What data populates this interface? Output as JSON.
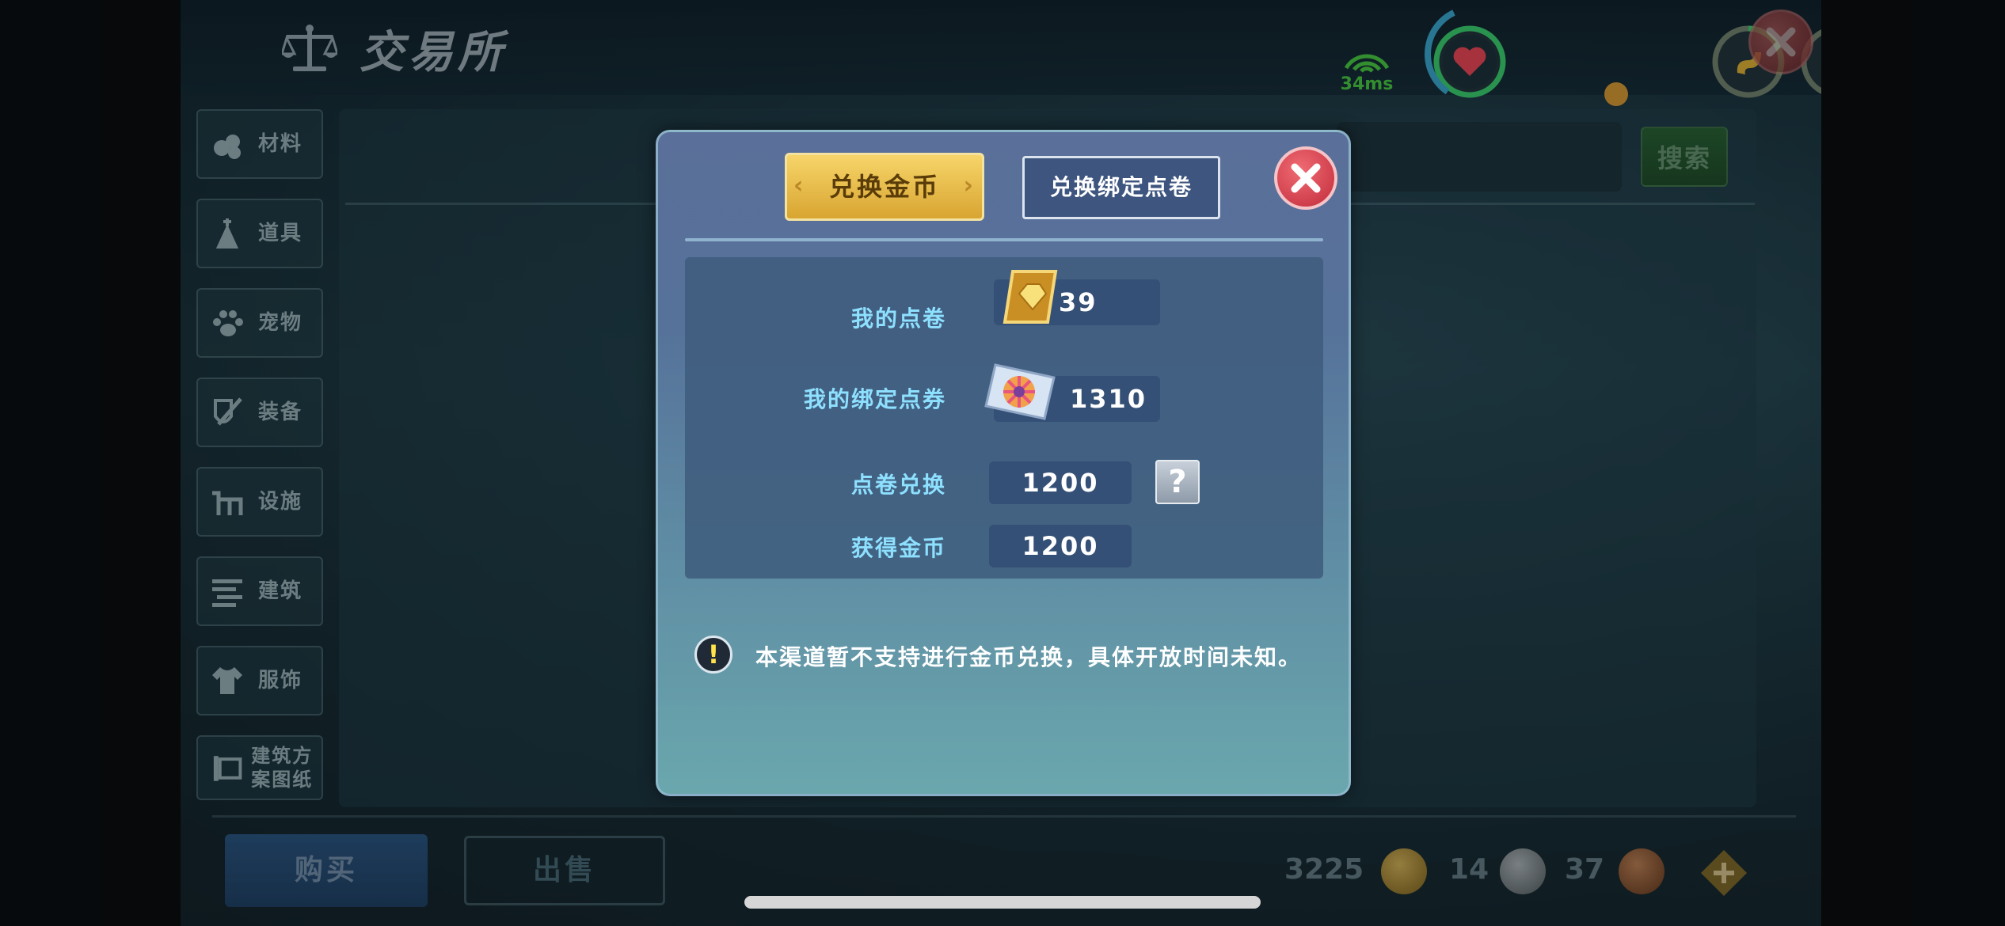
{
  "header": {
    "title": "交易所",
    "ping": "34ms"
  },
  "categories": [
    {
      "label": "材料",
      "icon": "material-icon"
    },
    {
      "label": "道具",
      "icon": "item-icon"
    },
    {
      "label": "宠物",
      "icon": "paw-icon"
    },
    {
      "label": "装备",
      "icon": "equipment-icon"
    },
    {
      "label": "设施",
      "icon": "facility-icon"
    },
    {
      "label": "建筑",
      "icon": "building-icon"
    },
    {
      "label": "服饰",
      "icon": "clothing-icon"
    },
    {
      "label": "建筑方案图纸",
      "icon": "blueprint-icon"
    }
  ],
  "search": {
    "button_label": "搜索"
  },
  "bottom": {
    "buy_label": "购买",
    "sell_label": "出售",
    "gold": "3225",
    "silver": "14",
    "copper": "37"
  },
  "modal": {
    "tab_exchange_gold": "兑换金币",
    "tab_exchange_bound": "兑换绑定点卷",
    "my_points_label": "我的点卷",
    "my_points_value": "39",
    "my_bound_label": "我的绑定点券",
    "my_bound_value": "1310",
    "exchange_label": "点卷兑换",
    "exchange_value": "1200",
    "gain_label": "获得金币",
    "gain_value": "1200",
    "help_label": "?",
    "warning_mark": "!",
    "notice": "本渠道暂不支持进行金币兑换，具体开放时间未知。"
  },
  "colors": {
    "accent_gold": "#e8bd4a",
    "label_cyan": "#8ee0ff",
    "health": "#ff4d5e",
    "status_ring": "#3fe07a",
    "ping": "#4fdb4a"
  }
}
